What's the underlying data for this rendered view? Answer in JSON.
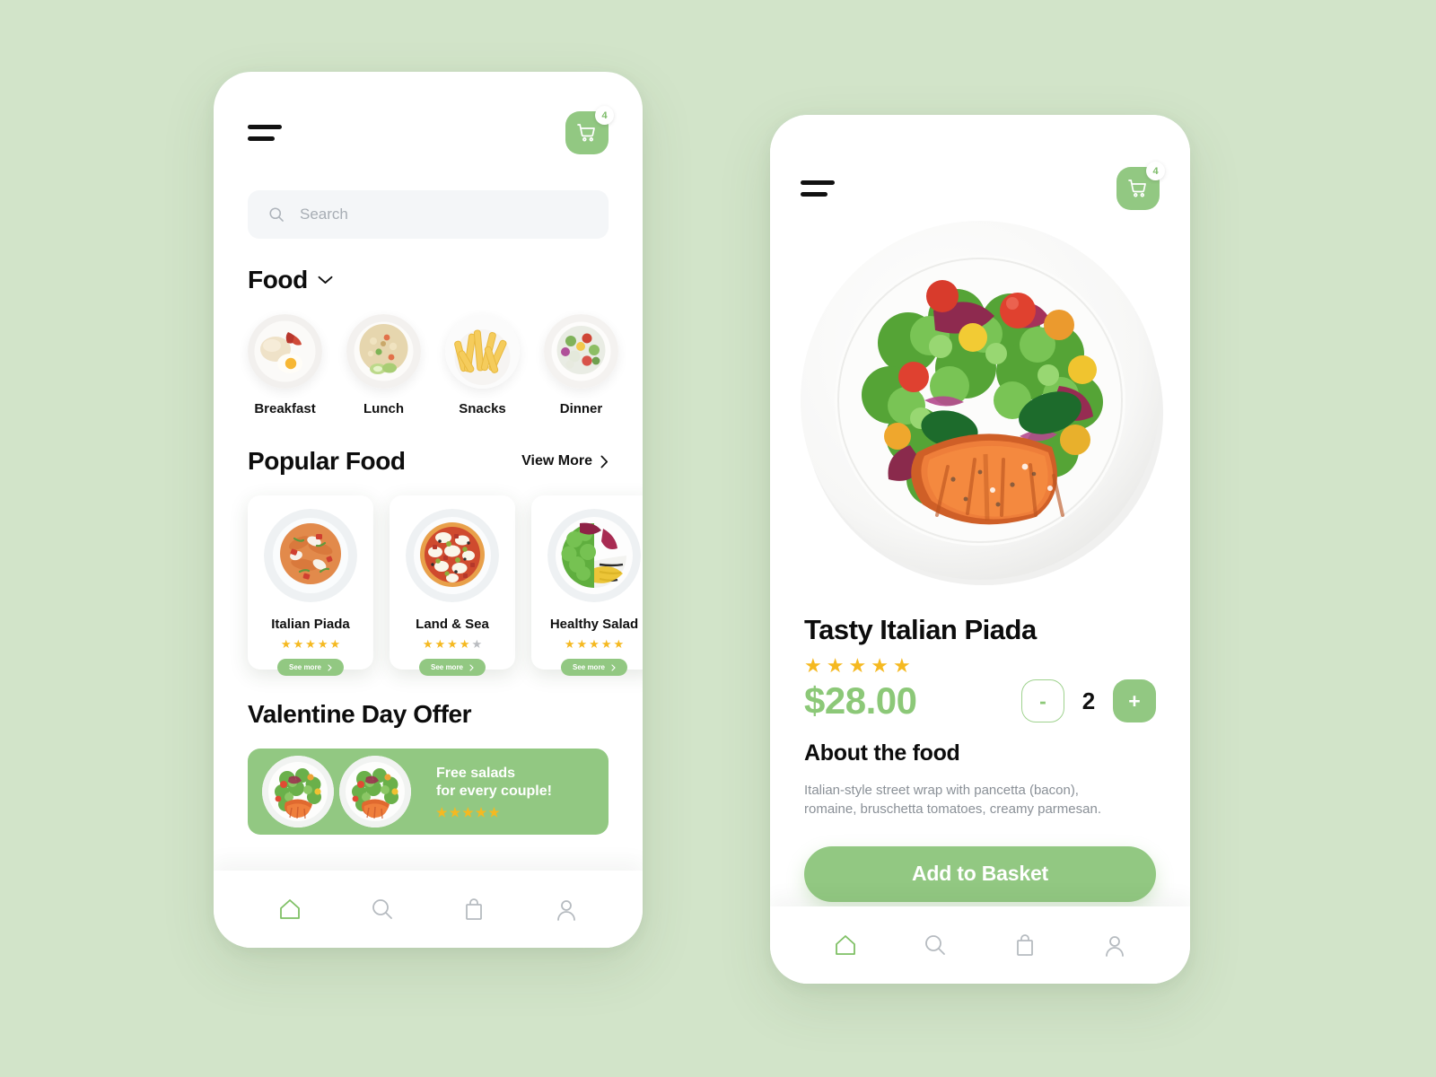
{
  "theme": {
    "background": "#d2e4c9",
    "accent_green": "#92c882",
    "price_green": "#8cc878",
    "star_gold": "#f5b921",
    "star_gray": "#b9bcc0"
  },
  "home": {
    "menu_icon": "hamburger-icon",
    "cart": {
      "icon": "cart-icon",
      "badge": "4"
    },
    "search": {
      "placeholder": "Search",
      "value": "",
      "icon": "search-icon"
    },
    "food_section": {
      "title": "Food",
      "chevron": "chevron-down-icon"
    },
    "categories": [
      {
        "label": "Breakfast",
        "image": "rice-egg-bacon-plate"
      },
      {
        "label": "Lunch",
        "image": "fried-rice-bowl"
      },
      {
        "label": "Snacks",
        "image": "french-fries-bowl"
      },
      {
        "label": "Dinner",
        "image": "mixed-salad-bowl"
      }
    ],
    "popular": {
      "title": "Popular Food",
      "view_more": "View More",
      "view_more_icon": "chevron-right-icon",
      "items": [
        {
          "name": "Italian Piada",
          "rating": 5,
          "max_rating": 5,
          "cta": "See more",
          "image": "piada-pasta-bowl"
        },
        {
          "name": "Land & Sea",
          "rating": 4,
          "max_rating": 5,
          "cta": "See more",
          "image": "pizza-top-view"
        },
        {
          "name": "Healthy Salad",
          "rating": 5,
          "max_rating": 5,
          "cta": "See more",
          "image": "green-salad-plate"
        }
      ]
    },
    "offer": {
      "title": "Valentine Day Offer",
      "line1": "Free salads",
      "line2": "for every couple!",
      "rating": 5,
      "image": "salmon-salad-plate"
    },
    "bottom_nav": [
      {
        "name": "home",
        "icon": "home-icon",
        "active": true
      },
      {
        "name": "search",
        "icon": "search-icon",
        "active": false
      },
      {
        "name": "bag",
        "icon": "shopping-bag-icon",
        "active": false
      },
      {
        "name": "profile",
        "icon": "user-icon",
        "active": false
      }
    ]
  },
  "detail": {
    "menu_icon": "hamburger-icon",
    "cart": {
      "icon": "cart-icon",
      "badge": "4"
    },
    "hero_image": "grilled-salmon-salad-plate",
    "title": "Tasty Italian Piada",
    "rating": 5,
    "price": "$28.00",
    "quantity": "2",
    "minus_label": "-",
    "plus_label": "+",
    "about_title": "About the food",
    "about_text": "Italian-style street wrap with pancetta (bacon), romaine, bruschetta tomatoes, creamy parmesan.",
    "add_to_basket": "Add to Basket",
    "bottom_nav": [
      {
        "name": "home",
        "icon": "home-icon",
        "active": true
      },
      {
        "name": "search",
        "icon": "search-icon",
        "active": false
      },
      {
        "name": "bag",
        "icon": "shopping-bag-icon",
        "active": false
      },
      {
        "name": "profile",
        "icon": "user-icon",
        "active": false
      }
    ]
  }
}
